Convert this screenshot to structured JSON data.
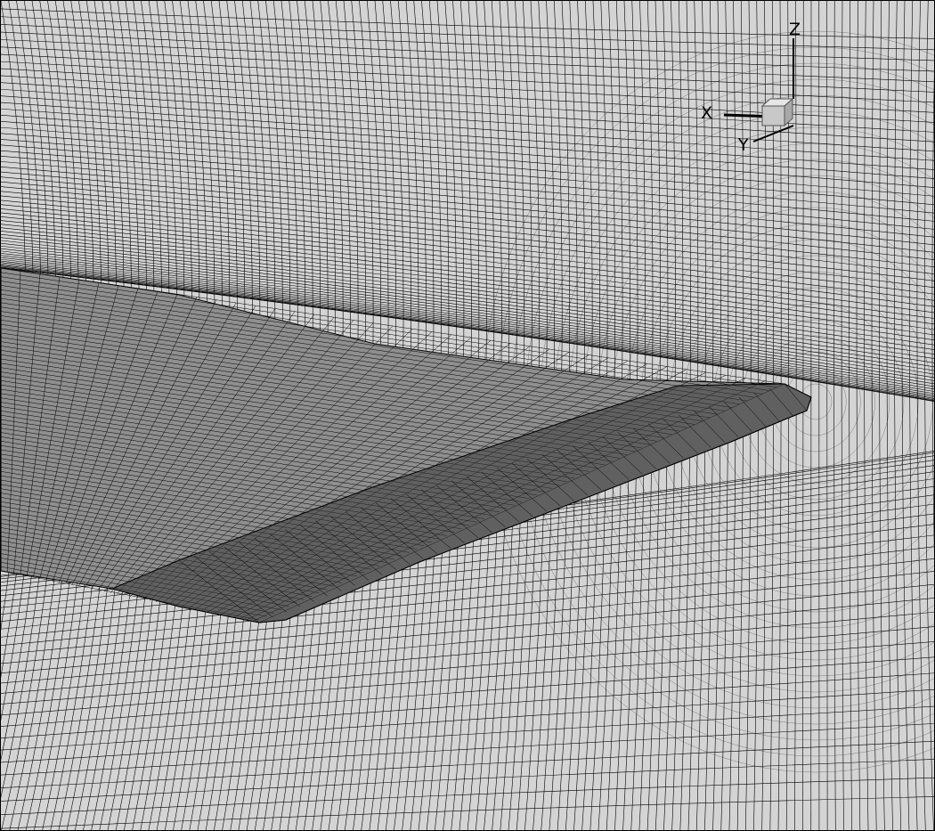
{
  "scene": {
    "background_color": "#d4d4d4",
    "grid_line_color": "#000000",
    "wing_surface_color": "#8c8c8c",
    "axis_triad": {
      "x_label": "X",
      "y_label": "Y",
      "z_label": "Z",
      "cube_color": "#c8c8c8"
    }
  }
}
